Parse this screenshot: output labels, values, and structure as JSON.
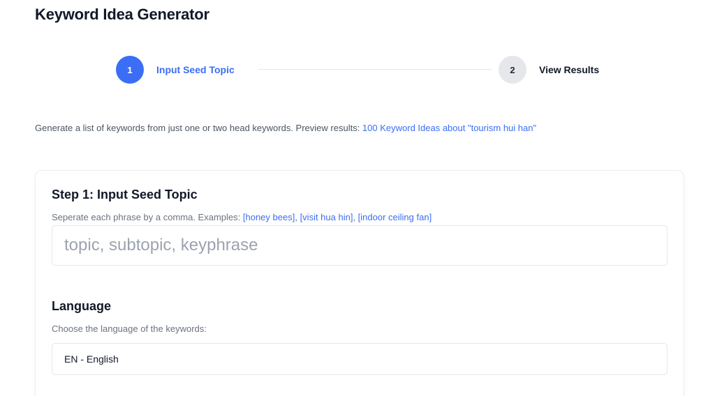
{
  "page": {
    "title": "Keyword Idea Generator"
  },
  "stepper": {
    "steps": [
      {
        "number": "1",
        "label": "Input Seed Topic",
        "state": "active"
      },
      {
        "number": "2",
        "label": "View Results",
        "state": "inactive"
      }
    ]
  },
  "intro": {
    "text": "Generate a list of keywords from just one or two head keywords. Preview results: ",
    "link": "100 Keyword Ideas about \"tourism hui han\""
  },
  "step1": {
    "title": "Step 1: Input Seed Topic",
    "hint_prefix": "Seperate each phrase by a comma. Examples: ",
    "examples": [
      "[honey bees]",
      "[visit hua hin]",
      "[indoor ceiling fan]"
    ],
    "input_value": "",
    "input_placeholder": "topic, subtopic, keyphrase"
  },
  "language": {
    "title": "Language",
    "hint": "Choose the language of the keywords:",
    "selected": "EN - English"
  },
  "colors": {
    "accent": "#3b6ef5",
    "inactive_step": "#e5e7eb",
    "muted_text": "#6b7280"
  }
}
